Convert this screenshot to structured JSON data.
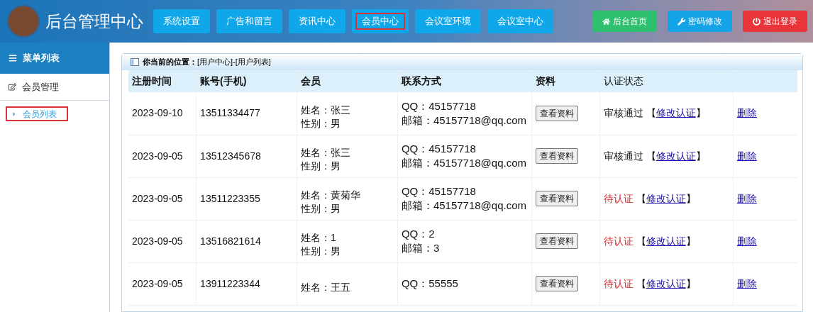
{
  "header": {
    "title": "后台管理中心",
    "nav": [
      {
        "label": "系统设置",
        "selected": false
      },
      {
        "label": "广告和留言",
        "selected": false
      },
      {
        "label": "资讯中心",
        "selected": false
      },
      {
        "label": "会员中心",
        "selected": true
      },
      {
        "label": "会议室环境",
        "selected": false
      },
      {
        "label": "会议室中心",
        "selected": false
      }
    ],
    "actions": [
      {
        "label": "后台首页",
        "kind": "home"
      },
      {
        "label": "密码修改",
        "kind": "password"
      },
      {
        "label": "退出登录",
        "kind": "logout"
      }
    ]
  },
  "sidebar": {
    "title": "菜单列表",
    "section": "会员管理",
    "items": [
      {
        "label": "会员列表",
        "selected": true
      }
    ]
  },
  "breadcrumb": {
    "label": "你当前的位置：",
    "path": "[用户中心]-[用户列表]"
  },
  "table": {
    "columns": [
      "注册时间",
      "账号(手机)",
      "会员",
      "联系方式",
      "资料",
      "认证状态"
    ],
    "rows": [
      {
        "date": "2023-09-10",
        "account": "13511334477",
        "name": "姓名：张三",
        "gender": "性别：男",
        "qq": "QQ：45157718",
        "email": "邮箱：45157718@qq.com",
        "view": "查看资料",
        "status": "审核通过",
        "color": "#222222",
        "open": "【",
        "edit": "修改认证",
        "close": "】",
        "delete": "删除"
      },
      {
        "date": "2023-09-05",
        "account": "13512345678",
        "name": "姓名：张三",
        "gender": "性别：男",
        "qq": "QQ：45157718",
        "email": "邮箱：45157718@qq.com",
        "view": "查看资料",
        "status": "审核通过",
        "color": "#222222",
        "open": "【",
        "edit": "修改认证",
        "close": "】",
        "delete": "删除"
      },
      {
        "date": "2023-09-05",
        "account": "13511223355",
        "name": "姓名：黄菊华",
        "gender": "性别：男",
        "qq": "QQ：45157718",
        "email": "邮箱：45157718@qq.com",
        "view": "查看资料",
        "status": "待认证",
        "color": "#e0262c",
        "open": "【",
        "edit": "修改认证",
        "close": "】",
        "delete": "删除"
      },
      {
        "date": "2023-09-05",
        "account": "13516821614",
        "name": "姓名：1",
        "gender": "性别：男",
        "qq": "QQ：2",
        "email": "邮箱：3",
        "view": "查看资料",
        "status": "待认证",
        "color": "#e0262c",
        "open": "【",
        "edit": "修改认证",
        "close": "】",
        "delete": "删除"
      },
      {
        "date": "2023-09-05",
        "account": "13911223344",
        "name": "姓名：王五",
        "qq": "QQ：55555",
        "view": "查看资料",
        "status": "待认证",
        "color": "#e0262c",
        "open": "【",
        "edit": "修改认证",
        "close": "】",
        "delete": "删除"
      }
    ]
  }
}
